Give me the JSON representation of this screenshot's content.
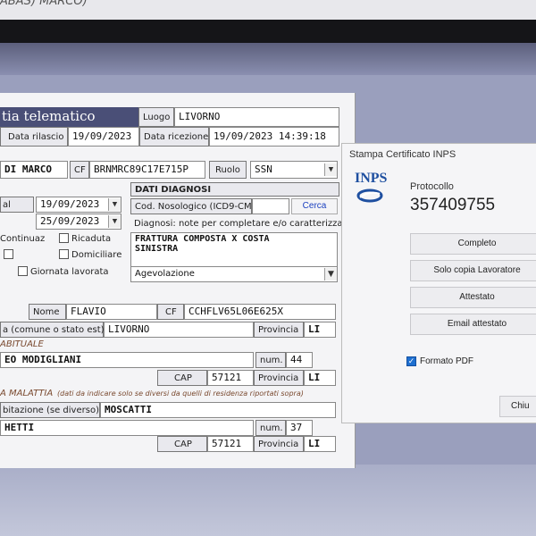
{
  "window_title": "ABAS) MARCO)",
  "form": {
    "header_title": "tia telematico",
    "luogo_label": "Luogo",
    "luogo_value": "LIVORNO",
    "data_rilascio_label": "Data rilascio",
    "data_rilascio_value": "19/09/2023",
    "data_ricezione_label": "Data ricezione",
    "data_ricezione_value": "19/09/2023 14:39:18",
    "name_value": "DI MARCO",
    "cf_label": "CF",
    "cf_value": "BRNMRC89C17E715P",
    "ruolo_label": "Ruolo",
    "ruolo_value": "SSN",
    "dal_label": "al",
    "date1_value": "19/09/2023",
    "date2_value": "25/09/2023",
    "continuaz_label": "Continuaz",
    "ricaduta_label": "Ricaduta",
    "domiciliare_label": "Domiciliare",
    "giornata_label": "Giornata lavorata",
    "dati_diagnosi_label": "DATI DIAGNOSI",
    "cod_nosologico_label": "Cod. Nosologico (ICD9-CM)",
    "cerca_label": "Cerca",
    "diagnosi_note_label": "Diagnosi: note per completare e/o caratterizzare",
    "diagnosi_line1": "FRATTURA COMPOSTA X COSTA",
    "diagnosi_line2": "SINISTRA",
    "agevolazione_label": "Agevolazione",
    "nome_label": "Nome",
    "nome_value": "FLAVIO",
    "cf2_label": "CF",
    "cf2_value": "CCHFLV65L06E625X",
    "luogo_nascita_label": "a (comune o stato est)",
    "luogo_nascita_value": "LIVORNO",
    "provincia_label": "Provincia",
    "provincia_value": "LI",
    "residenza_section": "ABITUALE",
    "indirizzo_value": "EO MODIGLIANI",
    "num_label": "num.",
    "num_value": "44",
    "cap_label": "CAP",
    "cap_value": "57121",
    "provincia2_label": "Provincia",
    "provincia2_value": "LI",
    "malattia_section": "A MALATTIA",
    "malattia_note": "(dati da indicare solo se diversi da quelli di residenza riportati sopra)",
    "abitazione_label": "bitazione (se diverso)",
    "abitazione_value": "MOSCATTI",
    "indirizzo2_value": "HETTI",
    "num2_label": "num.",
    "num2_value": "37",
    "cap2_label": "CAP",
    "cap2_value": "57121",
    "provincia3_label": "Provincia",
    "provincia3_value": "LI"
  },
  "dialog": {
    "title": "Stampa Certificato INPS",
    "logo_text": "INPS",
    "protocollo_label": "Protocollo",
    "protocollo_value": "357409755",
    "buttons": [
      "Completo",
      "Solo copia Lavoratore",
      "Attestato",
      "Email attestato"
    ],
    "formato_pdf_label": "Formato PDF",
    "formato_pdf_checked": true,
    "close_label": "Chiu"
  },
  "colors": {
    "accent": "#4a4f77",
    "inps_blue": "#1e4fa0"
  }
}
